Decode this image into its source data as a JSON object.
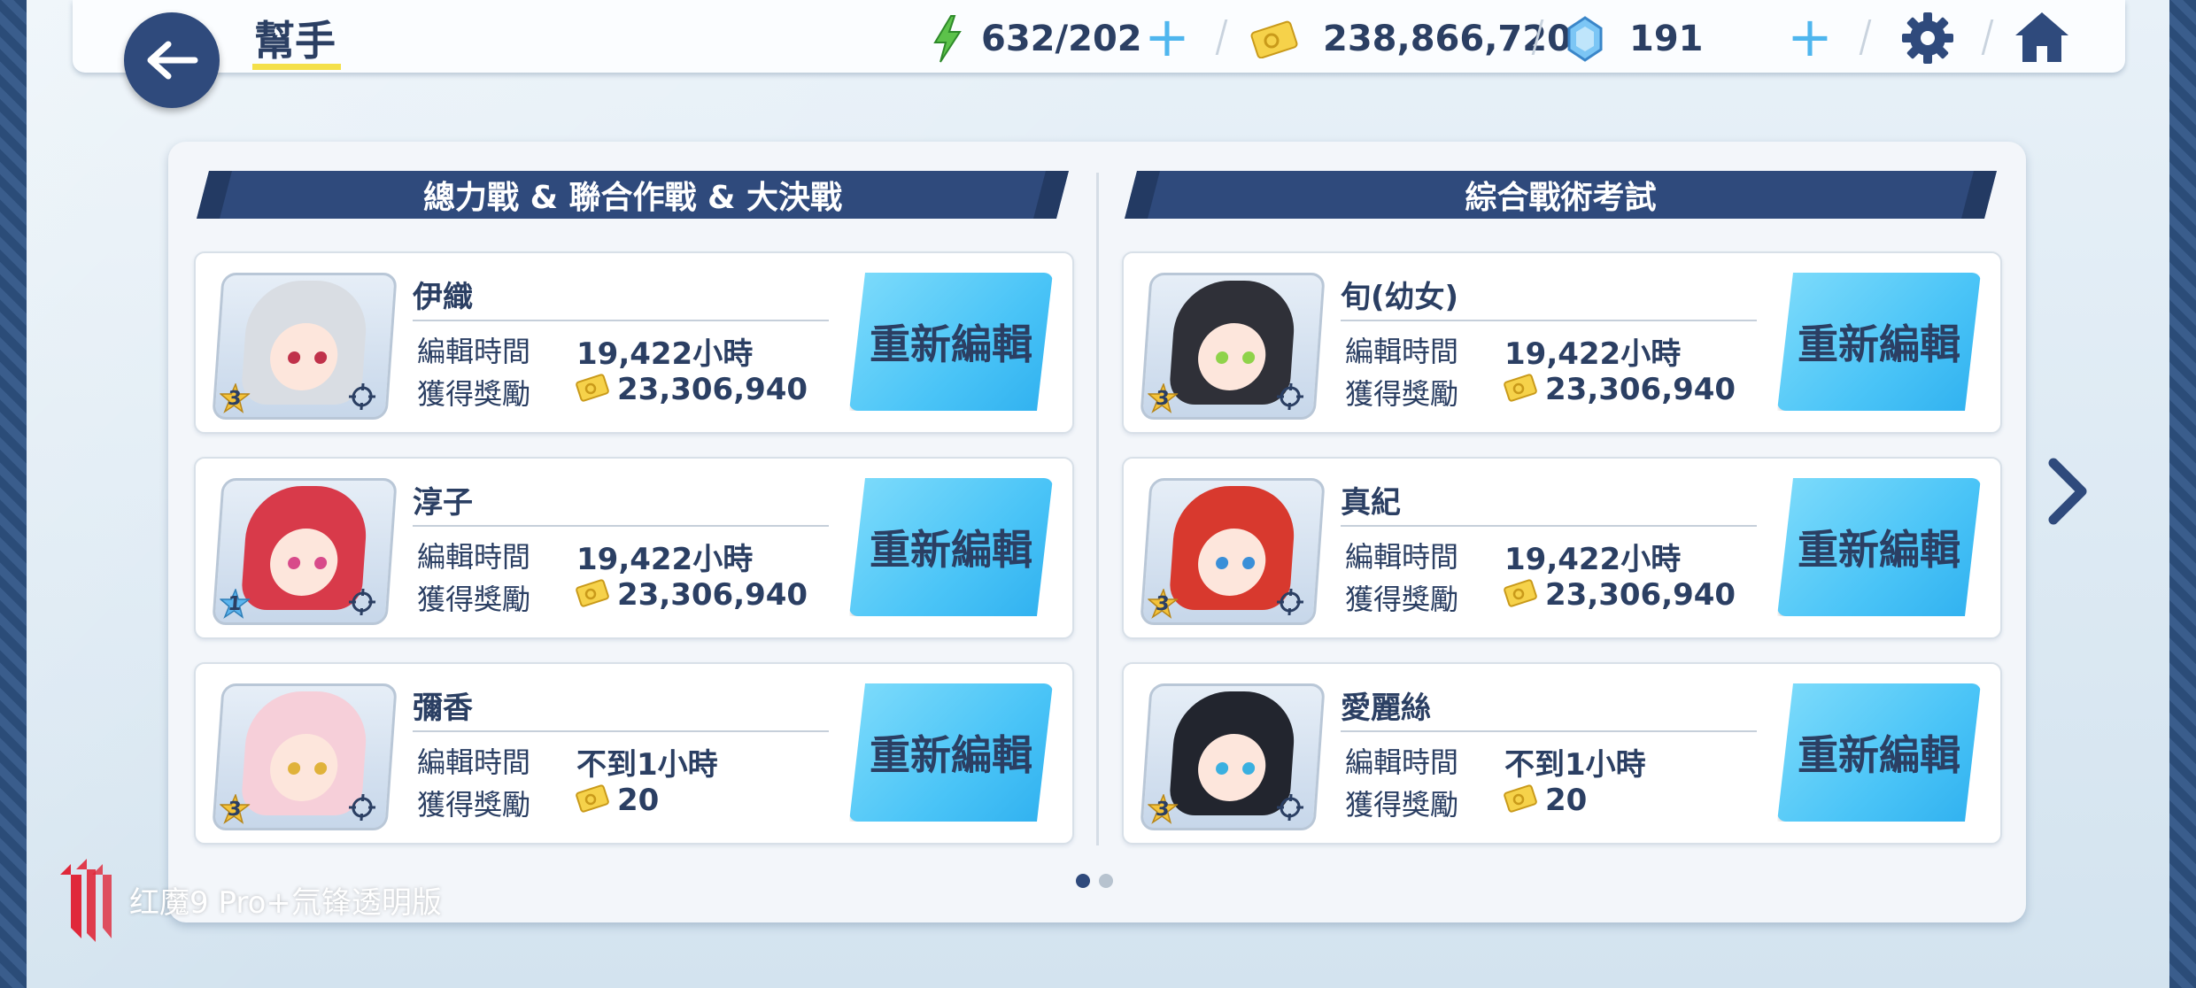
{
  "header": {
    "title": "幫手",
    "stamina": "632/202",
    "credits": "238,866,720",
    "gems": "191"
  },
  "sections": [
    {
      "title": "總力戰 & 聯合作戰 & 大決戰",
      "cards": [
        {
          "name": "伊織",
          "time_label": "編輯時間",
          "time": "19,422小時",
          "reward_label": "獲得獎勵",
          "reward": "23,306,940",
          "stars": "3",
          "button": "重新編輯"
        },
        {
          "name": "淳子",
          "time_label": "編輯時間",
          "time": "19,422小時",
          "reward_label": "獲得獎勵",
          "reward": "23,306,940",
          "stars": "1",
          "button": "重新編輯"
        },
        {
          "name": "彌香",
          "time_label": "編輯時間",
          "time": "不到1小時",
          "reward_label": "獲得獎勵",
          "reward": "20",
          "stars": "3",
          "button": "重新編輯"
        }
      ]
    },
    {
      "title": "綜合戰術考試",
      "cards": [
        {
          "name": "旬(幼女)",
          "time_label": "編輯時間",
          "time": "19,422小時",
          "reward_label": "獲得獎勵",
          "reward": "23,306,940",
          "stars": "3",
          "button": "重新編輯"
        },
        {
          "name": "真紀",
          "time_label": "編輯時間",
          "time": "19,422小時",
          "reward_label": "獲得獎勵",
          "reward": "23,306,940",
          "stars": "3",
          "button": "重新編輯"
        },
        {
          "name": "愛麗絲",
          "time_label": "編輯時間",
          "time": "不到1小時",
          "reward_label": "獲得獎勵",
          "reward": "20",
          "stars": "3",
          "button": "重新編輯"
        }
      ]
    }
  ],
  "pagination": {
    "pages": 2,
    "current": 1
  },
  "watermark": "红魔9 Pro+氘锋透明版",
  "colors": {
    "navy": "#2f4a7c",
    "button_blue": "#4ac4f7",
    "gold": "#f4c33a",
    "text": "#2b3f63"
  }
}
